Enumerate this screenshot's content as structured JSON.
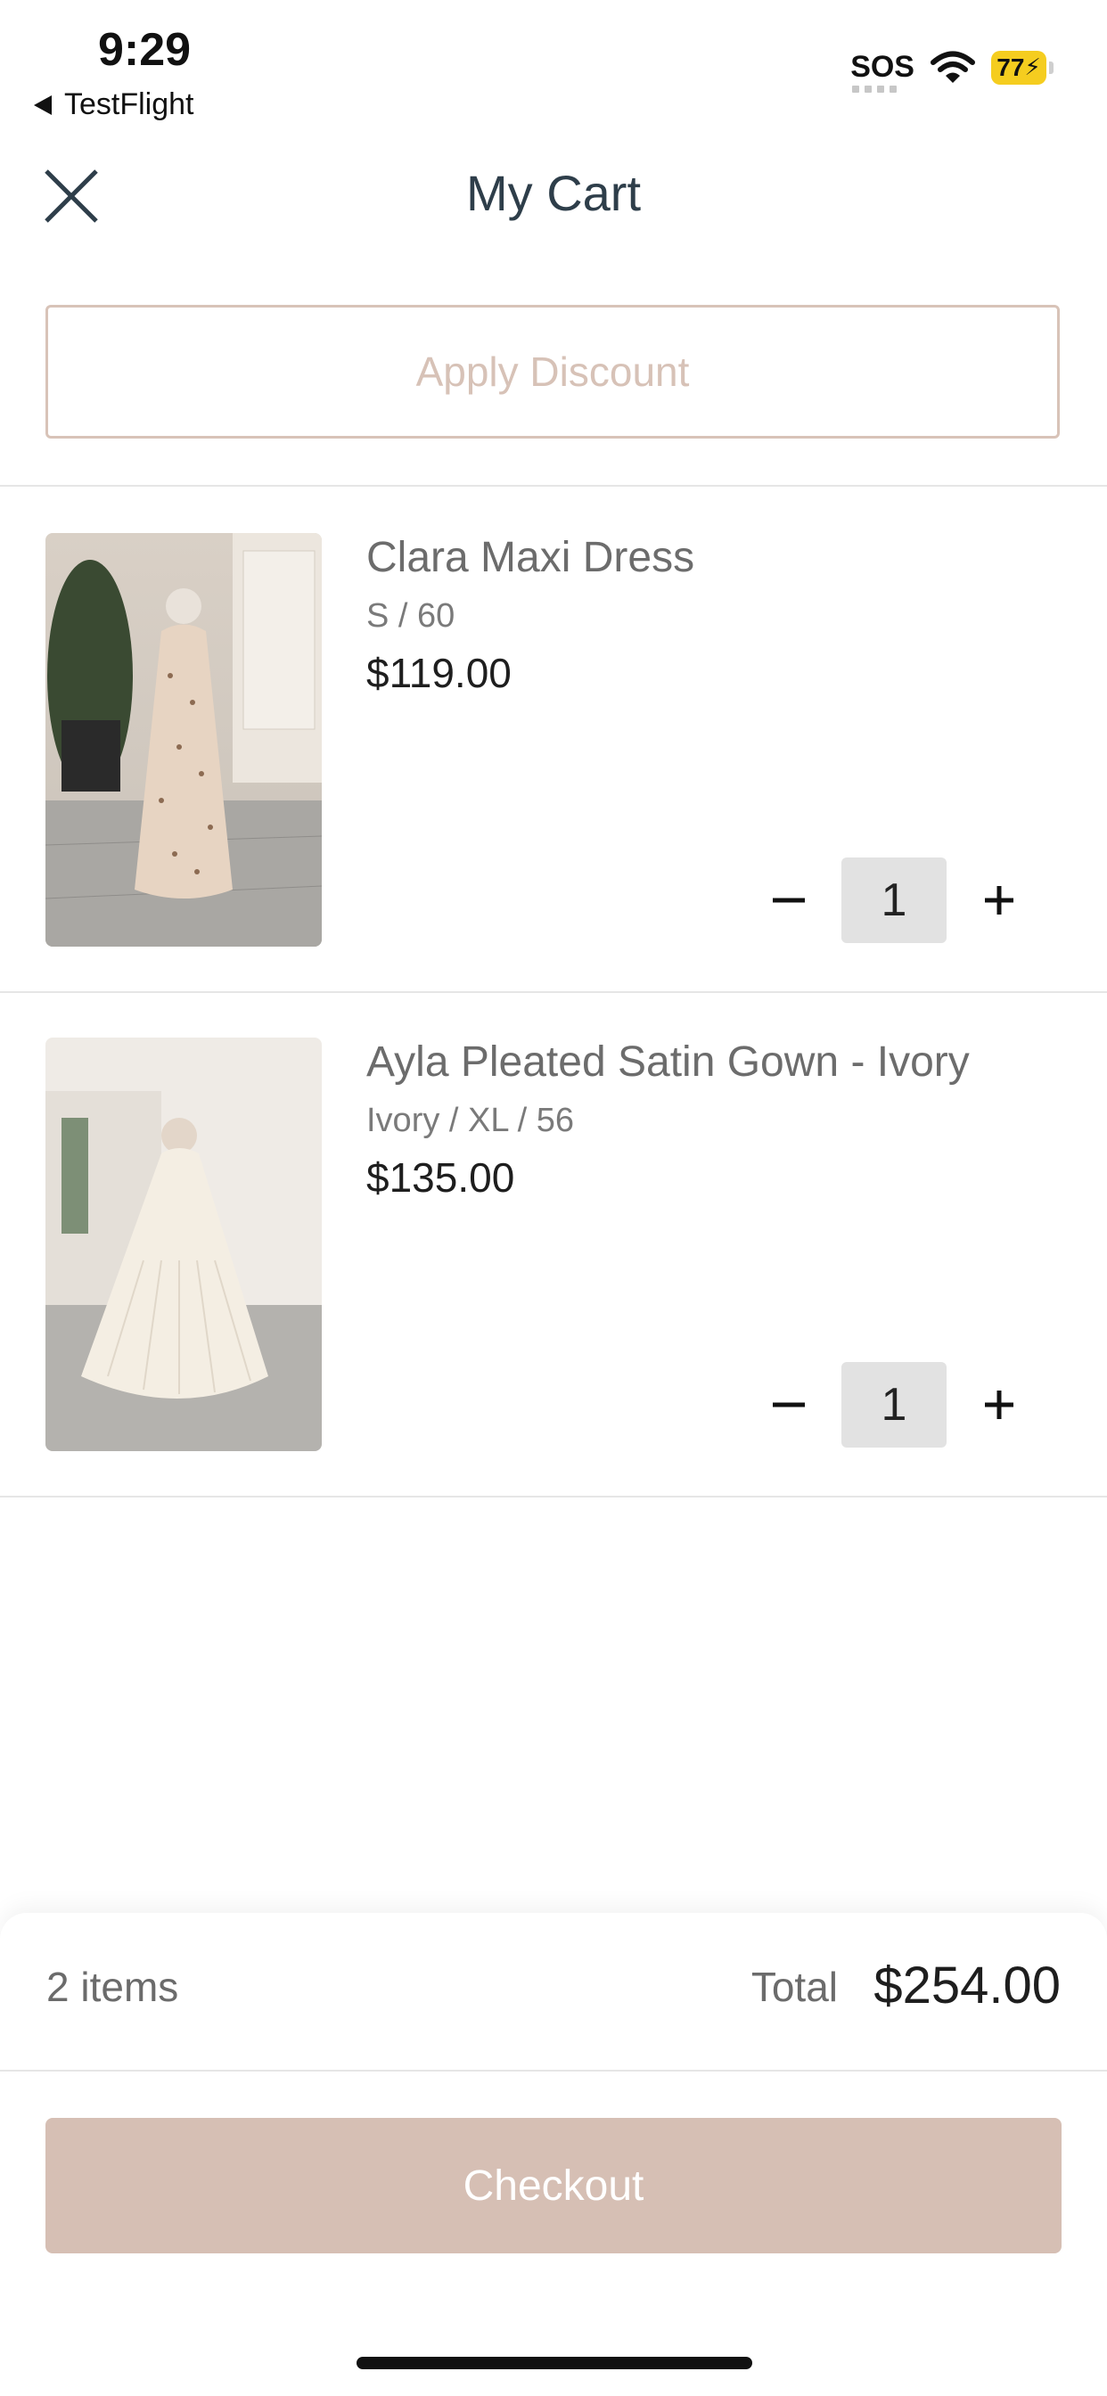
{
  "status_bar": {
    "time": "9:29",
    "back_app": "TestFlight",
    "sos": "SOS",
    "battery": "77"
  },
  "header": {
    "title": "My Cart",
    "close_icon": "close-icon"
  },
  "discount": {
    "label": "Apply Discount"
  },
  "cart_items": [
    {
      "name": "Clara Maxi Dress",
      "variant": "S / 60",
      "price": "$119.00",
      "quantity": "1"
    },
    {
      "name": "Ayla Pleated Satin Gown - Ivory",
      "variant": "Ivory / XL / 56",
      "price": "$135.00",
      "quantity": "1"
    }
  ],
  "summary": {
    "items_count": "2 items",
    "total_label": "Total",
    "total_value": "$254.00",
    "checkout_label": "Checkout"
  },
  "colors": {
    "accent": "#d6bfb4",
    "discount_border": "#d8c3b8",
    "title": "#2e3e4a",
    "battery": "#f5cd1f"
  }
}
